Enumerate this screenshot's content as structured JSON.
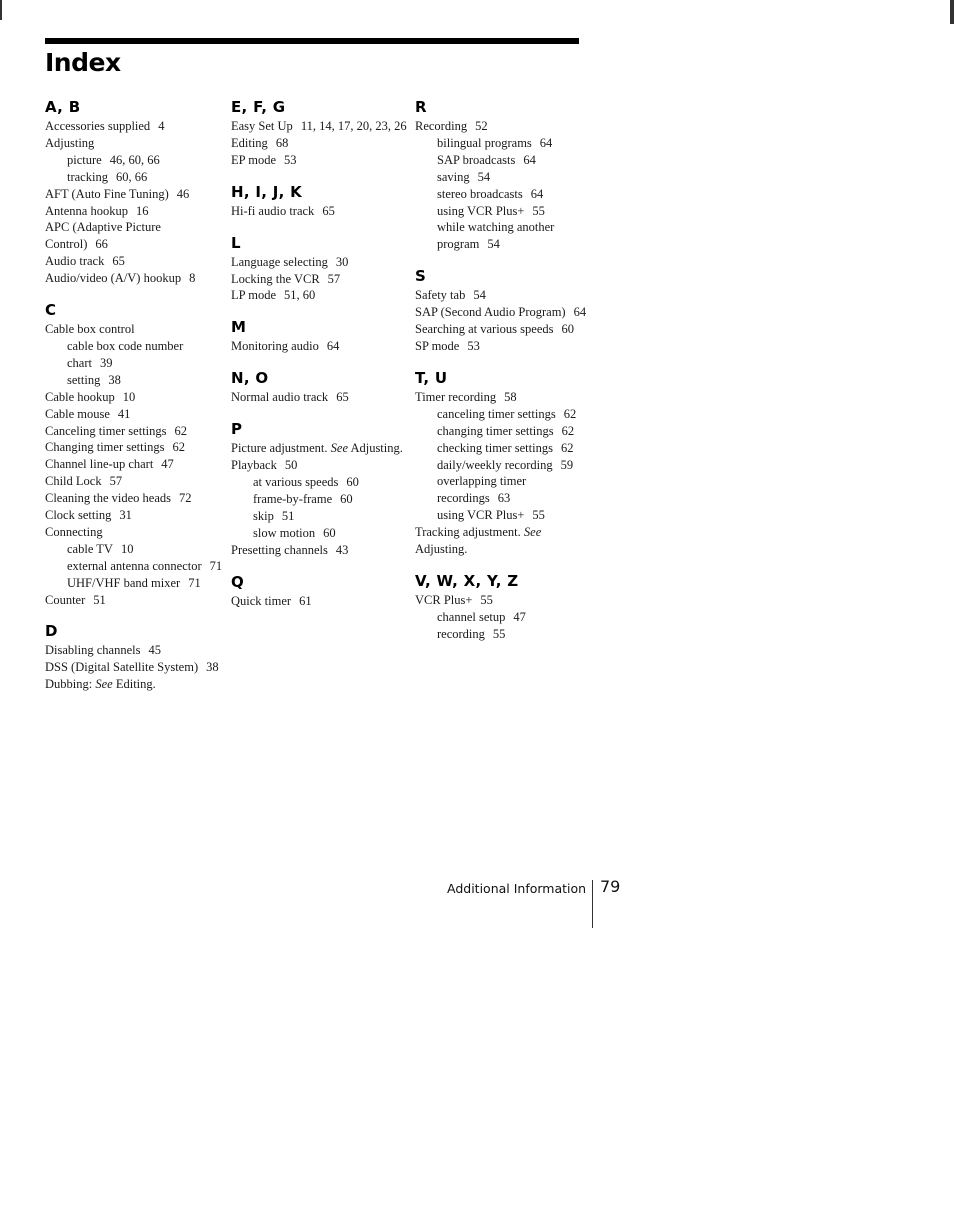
{
  "page": {
    "title": "Index",
    "footer_section": "Additional Information",
    "page_number": "79"
  },
  "columns": [
    {
      "sections": [
        {
          "heading": "A, B",
          "entries": [
            {
              "text": "Accessories supplied",
              "pages": "4",
              "level": 0
            },
            {
              "text": "Adjusting",
              "pages": "",
              "level": 0
            },
            {
              "text": "picture",
              "pages": "46, 60, 66",
              "level": 1
            },
            {
              "text": "tracking",
              "pages": "60, 66",
              "level": 1
            },
            {
              "text": "AFT (Auto Fine Tuning)",
              "pages": "46",
              "level": 0
            },
            {
              "text": "Antenna hookup",
              "pages": "16",
              "level": 0
            },
            {
              "text": "APC (Adaptive Picture Control)",
              "pages": "66",
              "level": 0
            },
            {
              "text": "Audio track",
              "pages": "65",
              "level": 0
            },
            {
              "text": "Audio/video (A/V) hookup",
              "pages": "8",
              "level": 0
            }
          ]
        },
        {
          "heading": "C",
          "entries": [
            {
              "text": "Cable box control",
              "pages": "",
              "level": 0
            },
            {
              "text": "cable box code number chart",
              "pages": "39",
              "level": 1
            },
            {
              "text": "setting",
              "pages": "38",
              "level": 1
            },
            {
              "text": "Cable hookup",
              "pages": "10",
              "level": 0
            },
            {
              "text": "Cable mouse",
              "pages": "41",
              "level": 0
            },
            {
              "text": "Canceling timer settings",
              "pages": "62",
              "level": 0
            },
            {
              "text": "Changing timer settings",
              "pages": "62",
              "level": 0
            },
            {
              "text": "Channel line-up chart",
              "pages": "47",
              "level": 0
            },
            {
              "text": "Child Lock",
              "pages": "57",
              "level": 0
            },
            {
              "text": "Cleaning the video heads",
              "pages": "72",
              "level": 0
            },
            {
              "text": "Clock setting",
              "pages": "31",
              "level": 0
            },
            {
              "text": "Connecting",
              "pages": "",
              "level": 0
            },
            {
              "text": "cable TV",
              "pages": "10",
              "level": 1
            },
            {
              "text": "external antenna connector",
              "pages": "71",
              "level": 1
            },
            {
              "text": "UHF/VHF band mixer",
              "pages": "71",
              "level": 1
            },
            {
              "text": "Counter",
              "pages": "51",
              "level": 0
            }
          ]
        },
        {
          "heading": "D",
          "entries": [
            {
              "text": "Disabling channels",
              "pages": "45",
              "level": 0
            },
            {
              "text": "DSS (Digital Satellite System)",
              "pages": "38",
              "level": 0
            },
            {
              "text": "Dubbing:",
              "see": "See",
              "see_target": "Editing.",
              "pages": "",
              "level": 0
            }
          ]
        }
      ]
    },
    {
      "sections": [
        {
          "heading": "E, F, G",
          "entries": [
            {
              "text": "Easy Set Up",
              "pages": "11, 14, 17, 20, 23, 26",
              "level": 0
            },
            {
              "text": "Editing",
              "pages": "68",
              "level": 0
            },
            {
              "text": "EP mode",
              "pages": "53",
              "level": 0
            }
          ]
        },
        {
          "heading": "H, I, J, K",
          "entries": [
            {
              "text": "Hi-fi audio track",
              "pages": "65",
              "level": 0
            }
          ]
        },
        {
          "heading": "L",
          "entries": [
            {
              "text": "Language selecting",
              "pages": "30",
              "level": 0
            },
            {
              "text": "Locking the VCR",
              "pages": "57",
              "level": 0
            },
            {
              "text": "LP mode",
              "pages": "51, 60",
              "level": 0
            }
          ]
        },
        {
          "heading": "M",
          "entries": [
            {
              "text": "Monitoring audio",
              "pages": "64",
              "level": 0
            }
          ]
        },
        {
          "heading": "N, O",
          "entries": [
            {
              "text": "Normal audio track",
              "pages": "65",
              "level": 0
            }
          ]
        },
        {
          "heading": "P",
          "entries": [
            {
              "text": "Picture adjustment.",
              "see": "See",
              "see_target": "Adjusting.",
              "pages": "",
              "level": 0
            },
            {
              "text": "Playback",
              "pages": "50",
              "level": 0
            },
            {
              "text": "at various speeds",
              "pages": "60",
              "level": 1
            },
            {
              "text": "frame-by-frame",
              "pages": "60",
              "level": 1
            },
            {
              "text": "skip",
              "pages": "51",
              "level": 1
            },
            {
              "text": "slow motion",
              "pages": "60",
              "level": 1
            },
            {
              "text": "Presetting channels",
              "pages": "43",
              "level": 0
            }
          ]
        },
        {
          "heading": "Q",
          "entries": [
            {
              "text": "Quick timer",
              "pages": "61",
              "level": 0
            }
          ]
        }
      ]
    },
    {
      "sections": [
        {
          "heading": "R",
          "entries": [
            {
              "text": "Recording",
              "pages": "52",
              "level": 0
            },
            {
              "text": "bilingual programs",
              "pages": "64",
              "level": 1
            },
            {
              "text": "SAP broadcasts",
              "pages": "64",
              "level": 1
            },
            {
              "text": "saving",
              "pages": "54",
              "level": 1
            },
            {
              "text": "stereo broadcasts",
              "pages": "64",
              "level": 1
            },
            {
              "text": "using VCR Plus+",
              "pages": "55",
              "level": 1
            },
            {
              "text": "while watching another program",
              "pages": "54",
              "level": 1
            }
          ]
        },
        {
          "heading": "S",
          "entries": [
            {
              "text": "Safety tab",
              "pages": "54",
              "level": 0
            },
            {
              "text": "SAP (Second Audio Program)",
              "pages": "64",
              "level": 0
            },
            {
              "text": "Searching at various speeds",
              "pages": "60",
              "level": 0
            },
            {
              "text": "SP mode",
              "pages": "53",
              "level": 0
            }
          ]
        },
        {
          "heading": "T, U",
          "entries": [
            {
              "text": "Timer recording",
              "pages": "58",
              "level": 0
            },
            {
              "text": "canceling timer settings",
              "pages": "62",
              "level": 1
            },
            {
              "text": "changing timer settings",
              "pages": "62",
              "level": 1
            },
            {
              "text": "checking timer settings",
              "pages": "62",
              "level": 1
            },
            {
              "text": "daily/weekly recording",
              "pages": "59",
              "level": 1
            },
            {
              "text": "overlapping timer recordings",
              "pages": "63",
              "level": 1
            },
            {
              "text": "using VCR Plus+",
              "pages": "55",
              "level": 1
            },
            {
              "text": "Tracking adjustment.",
              "see": "See",
              "see_target": "Adjusting.",
              "pages": "",
              "level": 0
            }
          ]
        },
        {
          "heading": "V, W, X, Y, Z",
          "entries": [
            {
              "text": "VCR Plus+",
              "pages": "55",
              "level": 0
            },
            {
              "text": "channel setup",
              "pages": "47",
              "level": 1
            },
            {
              "text": "recording",
              "pages": "55",
              "level": 1
            }
          ]
        }
      ]
    }
  ]
}
